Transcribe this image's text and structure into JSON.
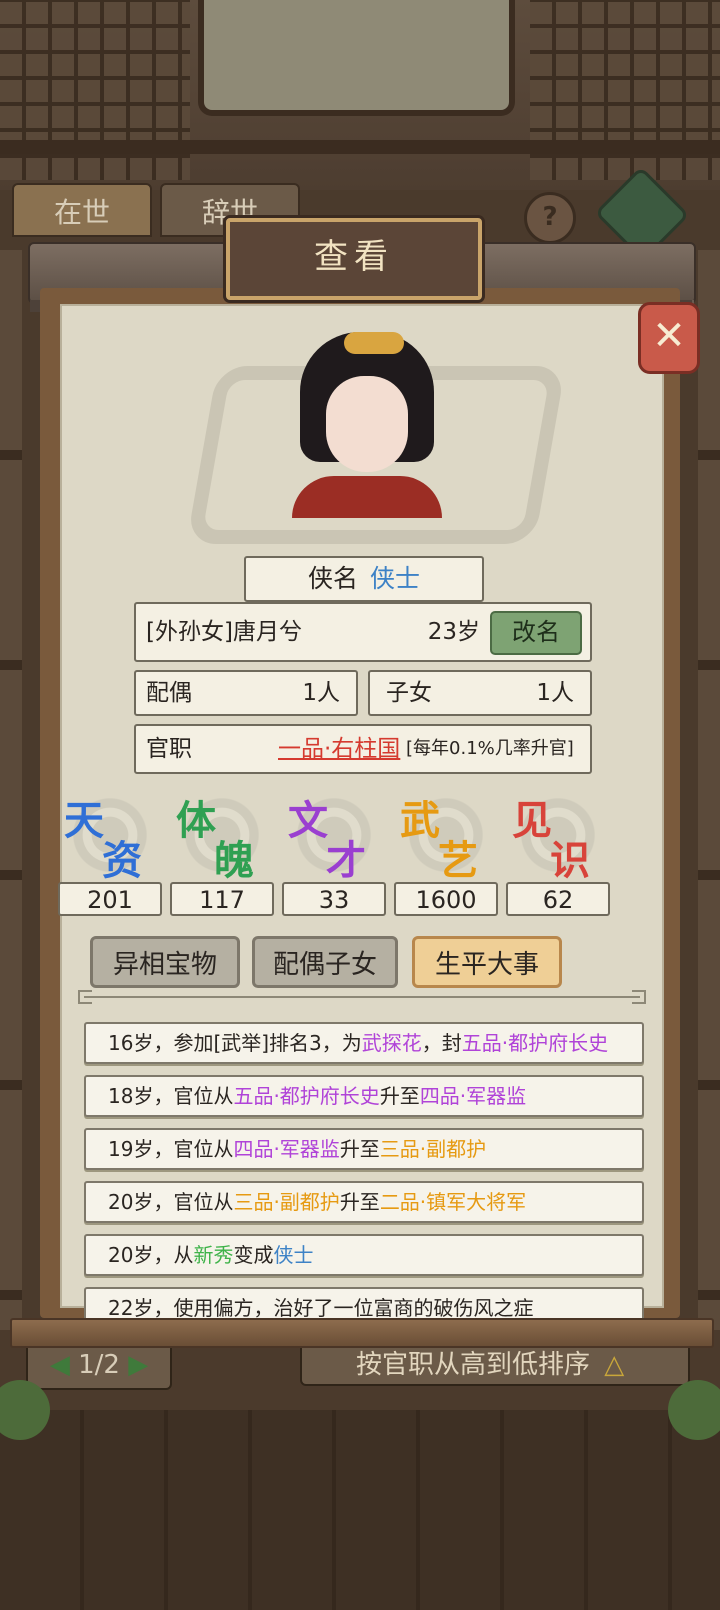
{
  "background": {
    "tabs": [
      "在世",
      "辞世"
    ],
    "help_label": "?",
    "pager": "1/2",
    "sort_label": "按官职从高到低排序"
  },
  "modal": {
    "title": "查看",
    "close_label": "✕",
    "title_name_label": "侠名",
    "title_name_value": "侠士",
    "person_name": "[外孙女]唐月兮",
    "age": "23岁",
    "rename_button": "改名",
    "spouse_label": "配偶",
    "spouse_count": "1人",
    "children_label": "子女",
    "children_count": "1人",
    "office_label": "官职",
    "office_rank": "一品·右柱国",
    "office_note": "[每年0.1%几率升官]"
  },
  "stats": [
    {
      "c1": "天",
      "c2": "资",
      "value": "201",
      "color": "#2f6fd6"
    },
    {
      "c1": "体",
      "c2": "魄",
      "value": "117",
      "color": "#2fa052"
    },
    {
      "c1": "文",
      "c2": "才",
      "value": "33",
      "color": "#9a3fd0"
    },
    {
      "c1": "武",
      "c2": "艺",
      "value": "1600",
      "color": "#e69a12"
    },
    {
      "c1": "见",
      "c2": "识",
      "value": "62",
      "color": "#d8433a"
    }
  ],
  "tabs": [
    {
      "label": "异相宝物",
      "active": false
    },
    {
      "label": "配偶子女",
      "active": false
    },
    {
      "label": "生平大事",
      "active": true
    }
  ],
  "events": [
    [
      {
        "t": "16岁，参加[武举]排名3，为"
      },
      {
        "t": "武探花",
        "c": "c-purple"
      },
      {
        "t": "，封"
      },
      {
        "t": "五品·都护府长史",
        "c": "c-purple"
      }
    ],
    [
      {
        "t": "18岁，官位从"
      },
      {
        "t": "五品·都护府长史",
        "c": "c-purple"
      },
      {
        "t": "升至"
      },
      {
        "t": "四品·军器监",
        "c": "c-purple"
      }
    ],
    [
      {
        "t": "19岁，官位从"
      },
      {
        "t": "四品·军器监",
        "c": "c-purple"
      },
      {
        "t": "升至"
      },
      {
        "t": "三品·副都护",
        "c": "c-orange"
      }
    ],
    [
      {
        "t": "20岁，官位从"
      },
      {
        "t": "三品·副都护",
        "c": "c-orange"
      },
      {
        "t": "升至"
      },
      {
        "t": "二品·镇军大将军",
        "c": "c-orange"
      }
    ],
    [
      {
        "t": "20岁，从"
      },
      {
        "t": "新秀",
        "c": "c-green"
      },
      {
        "t": "变成"
      },
      {
        "t": "侠士",
        "c": "c-blue"
      }
    ],
    [
      {
        "t": "22岁，使用偏方，治好了一位富商的破伤风之症"
      }
    ]
  ]
}
